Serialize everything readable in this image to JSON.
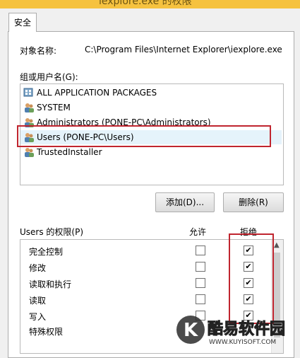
{
  "window": {
    "title": "iexplore.exe 的权限"
  },
  "tabs": [
    {
      "label": "安全"
    }
  ],
  "object": {
    "label": "对象名称:",
    "value": "C:\\Program Files\\Internet Explorer\\iexplore.exe"
  },
  "groups": {
    "label": "组或用户名(G):",
    "items": [
      {
        "name": "ALL APPLICATION PACKAGES",
        "icon": "packages-icon"
      },
      {
        "name": "SYSTEM",
        "icon": "users-icon"
      },
      {
        "name": "Administrators (PONE-PC\\Administrators)",
        "icon": "users-icon"
      },
      {
        "name": "Users (PONE-PC\\Users)",
        "icon": "users-icon",
        "highlighted": true
      },
      {
        "name": "TrustedInstaller",
        "icon": "users-icon"
      }
    ]
  },
  "buttons": {
    "add": "添加(D)...",
    "remove": "删除(R)"
  },
  "permissions": {
    "label": "Users 的权限(P)",
    "allow_header": "允许",
    "deny_header": "拒绝",
    "rows": [
      {
        "name": "完全控制",
        "allow": false,
        "deny": true
      },
      {
        "name": "修改",
        "allow": false,
        "deny": true
      },
      {
        "name": "读取和执行",
        "allow": false,
        "deny": true
      },
      {
        "name": "读取",
        "allow": false,
        "deny": true
      },
      {
        "name": "写入",
        "allow": false,
        "deny": true
      },
      {
        "name": "特殊权限",
        "allow": false,
        "deny": false
      }
    ]
  },
  "watermark": {
    "text": "酷易软件园",
    "url": "WWW.KUYISOFT.COM"
  },
  "colors": {
    "highlight_box": "#c0252f",
    "selection": "#e5f3fb",
    "titlebar": "#f6c23f"
  }
}
